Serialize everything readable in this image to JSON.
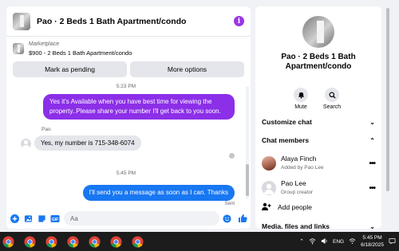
{
  "chat": {
    "title": "Pao · 2 Beds 1 Bath Apartment/condo",
    "listing": {
      "category": "Marketplace",
      "summary": "$900 - 2 Beds 1 Bath Apartment/condo",
      "mark_pending_label": "Mark as pending",
      "more_options_label": "More options"
    },
    "messages": [
      {
        "type": "timestamp",
        "text": "5:23 PM"
      },
      {
        "type": "outgoing",
        "text": "Yes it's Available when you have best time for viewing the property..Please share your number I'll get back to you soon."
      },
      {
        "type": "incoming",
        "sender": "Pao",
        "text": "Yes, my number is 715-348-6074"
      },
      {
        "type": "timestamp",
        "text": "5:45 PM"
      },
      {
        "type": "outgoing",
        "text": "I'll send you a message as soon as I can. Thanks"
      },
      {
        "type": "status",
        "text": "Sent"
      }
    ],
    "composer": {
      "placeholder": "Aa"
    }
  },
  "details": {
    "title": "Pao · 2 Beds 1 Bath Apartment/condo",
    "actions": [
      {
        "label": "Mute",
        "icon": "bell-icon"
      },
      {
        "label": "Search",
        "icon": "search-icon"
      }
    ],
    "sections": {
      "customize": "Customize chat",
      "members": "Chat members",
      "media": "Media, files and links"
    },
    "members": [
      {
        "name": "Alaya Finch",
        "sub": "Added by Pao Lee"
      },
      {
        "name": "Pao Lee",
        "sub": "Group creator"
      }
    ],
    "add_people": "Add people"
  },
  "taskbar": {
    "language": "ENG",
    "time": "5:45 PM",
    "date": "6/18/2025"
  },
  "colors": {
    "accent_purple": "#8c2fe8",
    "accent_blue": "#1877f2",
    "taskbar": "#1c1c1c"
  }
}
